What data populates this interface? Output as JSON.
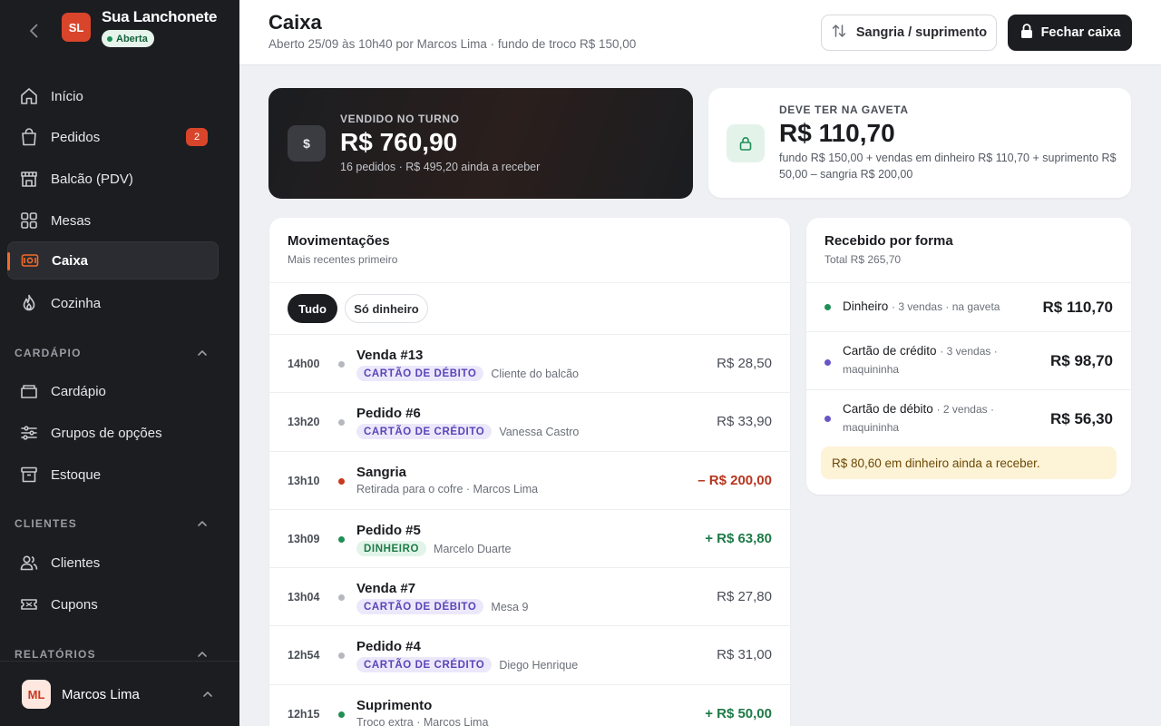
{
  "store": {
    "initials": "SL",
    "name": "Sua Lanchonete",
    "status": "Aberta"
  },
  "nav": {
    "items": [
      {
        "label": "Início",
        "icon": "home-icon"
      },
      {
        "label": "Pedidos",
        "icon": "bag-icon",
        "badge": "2"
      },
      {
        "label": "Balcão (PDV)",
        "icon": "store-icon"
      },
      {
        "label": "Mesas",
        "icon": "grid-icon"
      },
      {
        "label": "Caixa",
        "icon": "cash-icon",
        "active": true
      },
      {
        "label": "Cozinha",
        "icon": "flame-icon"
      }
    ],
    "cardapio_section": "CARDÁPIO",
    "cardapio_items": [
      {
        "label": "Cardápio",
        "icon": "tray-icon"
      },
      {
        "label": "Grupos de opções",
        "icon": "sliders-icon"
      },
      {
        "label": "Estoque",
        "icon": "archive-icon"
      }
    ],
    "clientes_section": "CLIENTES",
    "clientes_items": [
      {
        "label": "Clientes",
        "icon": "users-icon"
      },
      {
        "label": "Cupons",
        "icon": "ticket-icon"
      }
    ],
    "relatorios_section": "RELATÓRIOS"
  },
  "user": {
    "initials": "ML",
    "name": "Marcos Lima"
  },
  "header": {
    "title": "Caixa",
    "subtitle": "Aberto 25/09 às 10h40 por Marcos Lima · fundo de troco R$ 150,00",
    "sangria_button": "Sangria / suprimento",
    "close_button": "Fechar caixa"
  },
  "sold": {
    "label": "VENDIDO NO TURNO",
    "value": "R$ 760,90",
    "sub": "16 pedidos · R$ 495,20 ainda a receber",
    "icon": "$"
  },
  "drawer": {
    "label": "DEVE TER NA GAVETA",
    "value": "R$ 110,70",
    "sub": "fundo R$ 150,00 + vendas em dinheiro R$ 110,70 + suprimento R$ 50,00 – sangria R$ 200,00"
  },
  "movements": {
    "title": "Movimentações",
    "subtitle": "Mais recentes primeiro",
    "filters": [
      "Tudo",
      "Só dinheiro"
    ],
    "rows": [
      {
        "time": "14h00",
        "title": "Venda #13",
        "tag": "CARTÃO DE DÉBITO",
        "tag_kind": "purple",
        "detail": "Cliente do balcão",
        "amount": "R$ 28,50",
        "kind": "neutral"
      },
      {
        "time": "13h20",
        "title": "Pedido #6",
        "tag": "CARTÃO DE CRÉDITO",
        "tag_kind": "purple",
        "detail": "Vanessa Castro",
        "amount": "R$ 33,90",
        "kind": "neutral"
      },
      {
        "time": "13h10",
        "title": "Sangria",
        "tag": "",
        "tag_kind": "",
        "detail": "Retirada para o cofre · Marcos Lima",
        "amount": "– R$ 200,00",
        "kind": "out"
      },
      {
        "time": "13h09",
        "title": "Pedido #5",
        "tag": "DINHEIRO",
        "tag_kind": "green",
        "detail": "Marcelo Duarte",
        "amount": "+ R$ 63,80",
        "kind": "in"
      },
      {
        "time": "13h04",
        "title": "Venda #7",
        "tag": "CARTÃO DE DÉBITO",
        "tag_kind": "purple",
        "detail": "Mesa 9",
        "amount": "R$ 27,80",
        "kind": "neutral"
      },
      {
        "time": "12h54",
        "title": "Pedido #4",
        "tag": "CARTÃO DE CRÉDITO",
        "tag_kind": "purple",
        "detail": "Diego Henrique",
        "amount": "R$ 31,00",
        "kind": "neutral"
      },
      {
        "time": "12h15",
        "title": "Suprimento",
        "tag": "",
        "tag_kind": "",
        "detail": "Troco extra · Marcos Lima",
        "amount": "+ R$ 50,00",
        "kind": "in"
      }
    ]
  },
  "received": {
    "title": "Recebido por forma",
    "total": "Total R$ 265,70",
    "rows": [
      {
        "name": "Dinheiro",
        "detail": "· 3 vendas · na gaveta",
        "amount": "R$ 110,70",
        "color": "#1f8f55"
      },
      {
        "name": "Cartão de crédito",
        "detail": "· 3 vendas · maquininha",
        "amount": "R$ 98,70",
        "color": "#6a55c8"
      },
      {
        "name": "Cartão de débito",
        "detail": "· 2 vendas · maquininha",
        "amount": "R$ 56,30",
        "color": "#6a55c8"
      }
    ],
    "notice": "R$ 80,60 em dinheiro ainda a receber."
  },
  "colors": {
    "accent": "#f26b2a",
    "brand": "#d9452b",
    "green": "#1f8f55",
    "purple": "#6a55c8",
    "red": "#b8351e"
  }
}
